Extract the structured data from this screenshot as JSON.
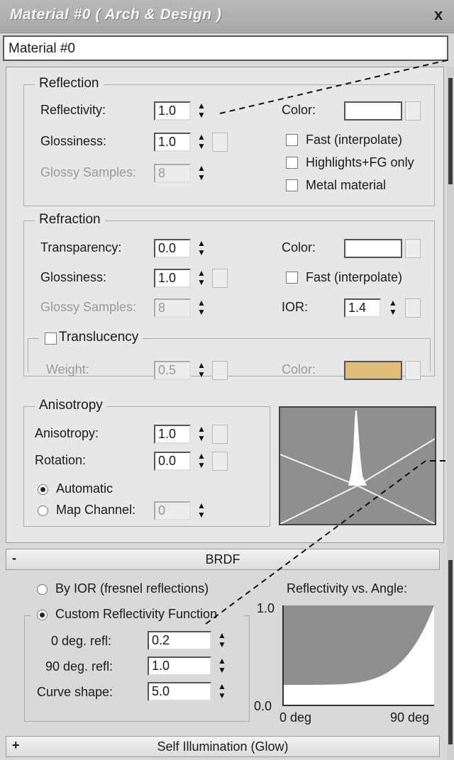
{
  "window": {
    "title": "Material #0  ( Arch & Design )",
    "close_glyph": "x",
    "material_name": "Material #0"
  },
  "reflection": {
    "group_label": "Reflection",
    "reflectivity_label": "Reflectivity:",
    "reflectivity_value": "1.0",
    "glossiness_label": "Glossiness:",
    "glossiness_value": "1.0",
    "glossy_samples_label": "Glossy Samples:",
    "glossy_samples_value": "8",
    "color_label": "Color:",
    "color_swatch": "#ffffff",
    "fast_interpolate_label": "Fast (interpolate)",
    "highlights_fg_label": "Highlights+FG only",
    "metal_material_label": "Metal material"
  },
  "refraction": {
    "group_label": "Refraction",
    "transparency_label": "Transparency:",
    "transparency_value": "0.0",
    "glossiness_label": "Glossiness:",
    "glossiness_value": "1.0",
    "glossy_samples_label": "Glossy Samples:",
    "glossy_samples_value": "8",
    "color_label": "Color:",
    "color_swatch": "#ffffff",
    "fast_interpolate_label": "Fast (interpolate)",
    "ior_label": "IOR:",
    "ior_value": "1.4",
    "translucency": {
      "label": "Translucency",
      "weight_label": "Weight:",
      "weight_value": "0.5",
      "color_label": "Color:",
      "color_swatch": "#dfbd79"
    }
  },
  "anisotropy": {
    "group_label": "Anisotropy",
    "anisotropy_label": "Anisotropy:",
    "anisotropy_value": "1.0",
    "rotation_label": "Rotation:",
    "rotation_value": "0.0",
    "automatic_label": "Automatic",
    "map_channel_label": "Map Channel:",
    "map_channel_value": "0",
    "selected_mode": "Automatic"
  },
  "brdf": {
    "rollout_sign": "-",
    "rollout_title": "BRDF",
    "by_ior_label": "By IOR (fresnel reflections)",
    "custom_label": "Custom Reflectivity Function",
    "selected_mode": "Custom Reflectivity Function",
    "deg0_label": "0 deg. refl:",
    "deg0_value": "0.2",
    "deg90_label": "90 deg. refl:",
    "deg90_value": "1.0",
    "curve_label": "Curve shape:",
    "curve_value": "5.0",
    "graph_title": "Reflectivity vs. Angle:",
    "graph_y_max": "1.0",
    "graph_y_min": "0.0",
    "graph_x_min": "0 deg",
    "graph_x_max": "90 deg"
  },
  "self_illum": {
    "rollout_sign": "+",
    "rollout_title": "Self Illumination (Glow)"
  },
  "colors": {
    "graph_fill": "#8f8f8f"
  }
}
